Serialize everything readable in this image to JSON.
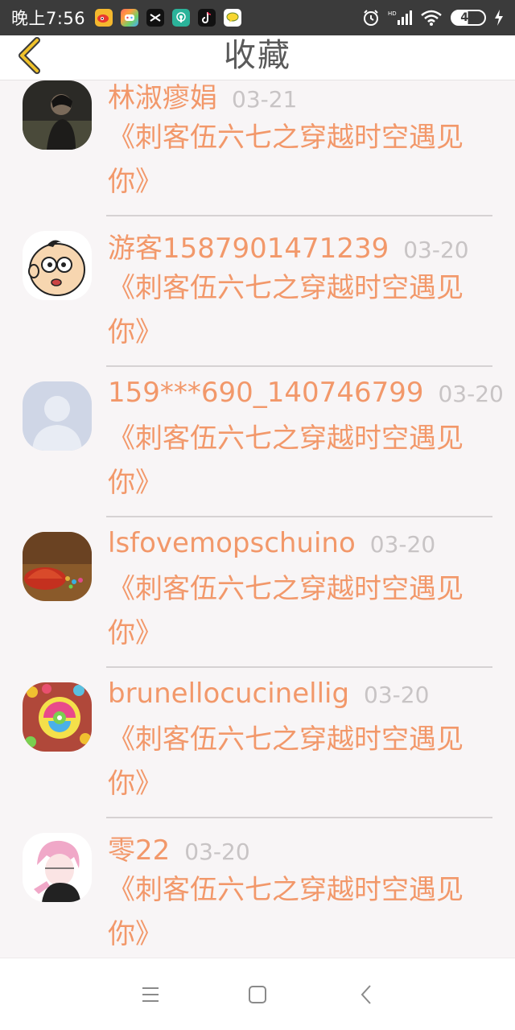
{
  "status_bar": {
    "time": "晚上7:56",
    "apps": [
      {
        "name": "weibo-icon",
        "color": "#f5b82e"
      },
      {
        "name": "game-center-icon",
        "color": "#e8495b"
      },
      {
        "name": "capcut-icon",
        "color": "#111111"
      },
      {
        "name": "podcast-icon",
        "color": "#2bb39a"
      },
      {
        "name": "tiktok-icon",
        "color": "#111111"
      },
      {
        "name": "chat-bubble-icon",
        "color": "#ffffff"
      }
    ],
    "battery_level": "49",
    "battery_percent": 49,
    "network_label": "HD"
  },
  "header": {
    "title": "收藏",
    "back_icon": "chevron-left-icon",
    "accent_color": "#f0c22a"
  },
  "list": {
    "items": [
      {
        "username": "林淑瘳娟",
        "date": "03-21",
        "title": "《刺客伍六七之穿越时空遇见你》",
        "avatar": "dark-photo"
      },
      {
        "username": "游客1587901471239",
        "date": "03-20",
        "title": "《刺客伍六七之穿越时空遇见你》",
        "avatar": "cartoon-face"
      },
      {
        "username": "159***690_140746799",
        "date": "03-20",
        "title": "《刺客伍六七之穿越时空遇见你》",
        "avatar": "default-user"
      },
      {
        "username": "lsfovemopschuino",
        "date": "03-20",
        "title": "《刺客伍六七之穿越时空遇见你》",
        "avatar": "brown-photo"
      },
      {
        "username": "brunellocucinellig",
        "date": "03-20",
        "title": "《刺客伍六七之穿越时空遇见你》",
        "avatar": "lollipop"
      },
      {
        "username": "零22",
        "date": "03-20",
        "title": "《刺客伍六七之穿越时空遇见你》",
        "avatar": "anime-pink"
      }
    ],
    "text_color": "#f2986a",
    "date_color": "#c8c4c5"
  },
  "nav_bar": {
    "buttons": [
      "menu-icon",
      "home-square-icon",
      "back-arrow-icon"
    ]
  }
}
